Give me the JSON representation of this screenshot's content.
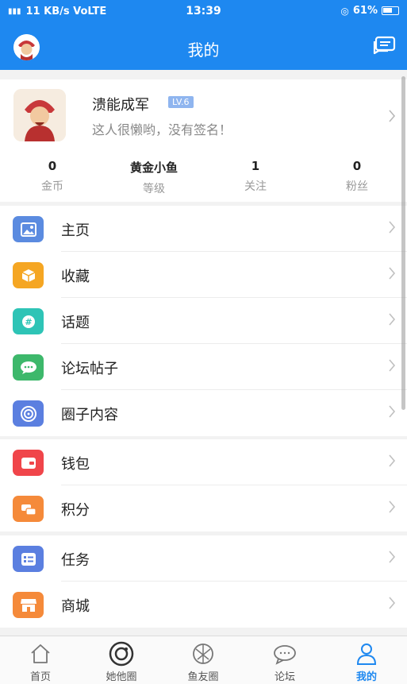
{
  "status_bar": {
    "left": "11 KB/s VoLTE",
    "time": "13:39",
    "battery": "61%"
  },
  "header": {
    "title": "我的"
  },
  "profile": {
    "name": "溃能成军",
    "level_badge": "LV.6",
    "signature": "这人很懒哟，没有签名！",
    "stats": [
      {
        "value": "0",
        "label": "金币"
      },
      {
        "value": "黄金小鱼",
        "label": "等级"
      },
      {
        "value": "1",
        "label": "关注"
      },
      {
        "value": "0",
        "label": "粉丝"
      }
    ]
  },
  "menu": {
    "group1": [
      {
        "label": "主页",
        "icon": "image-icon",
        "color": "#5b8be0"
      },
      {
        "label": "收藏",
        "icon": "box-icon",
        "color": "#f5a623"
      },
      {
        "label": "话题",
        "icon": "hashtag-icon",
        "color": "#2ec4b6"
      },
      {
        "label": "论坛帖子",
        "icon": "chat-icon",
        "color": "#3db86b"
      },
      {
        "label": "圈子内容",
        "icon": "circle-icon",
        "color": "#5b7fe0"
      }
    ],
    "group2": [
      {
        "label": "钱包",
        "icon": "wallet-icon",
        "color": "#f0454a"
      },
      {
        "label": "积分",
        "icon": "coins-icon",
        "color": "#f58a3a"
      }
    ],
    "group3": [
      {
        "label": "任务",
        "icon": "task-icon",
        "color": "#5b7fe0"
      },
      {
        "label": "商城",
        "icon": "shop-icon",
        "color": "#f58a3a"
      }
    ]
  },
  "tabbar": {
    "tabs": [
      {
        "label": "首页",
        "icon": "home-icon"
      },
      {
        "label": "她他圈",
        "icon": "camera-circle-icon"
      },
      {
        "label": "鱼友圈",
        "icon": "aperture-icon"
      },
      {
        "label": "论坛",
        "icon": "forum-icon"
      },
      {
        "label": "我的",
        "icon": "user-icon",
        "active": true
      }
    ]
  },
  "colors": {
    "brand": "#1e88f0",
    "active_tab": "#1e88f0"
  }
}
